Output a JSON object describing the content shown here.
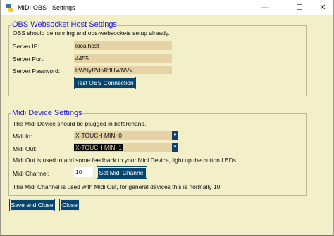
{
  "window": {
    "title": "MIDI-OBS - Settings",
    "controls": {
      "minimize": "—",
      "maximize": "☐",
      "close": "✕"
    }
  },
  "obs": {
    "heading": "OBS Websocket Host Settings",
    "note": "OBS should be running and obs-websockets setup already.",
    "ip_label": "Server IP:",
    "ip_value": "localhost",
    "port_label": "Server Port:",
    "port_value": "4455",
    "password_label": "Server Password:",
    "password_value": "hWNyfZdhRflUWNVk",
    "test_button": "Test OBS Connection"
  },
  "midi": {
    "heading": "Midi Device Settings",
    "note": "The Midi Device should be plugged in beforehand.",
    "in_label": "Midi In:",
    "in_value": "X-TOUCH MINI 0",
    "out_label": "Midi Out:",
    "out_value": "X-TOUCH MINI 1",
    "out_note": "Midi Out is used to add some feedback to your Midi Device, light up the button LEDs",
    "channel_label": "Midi Channel:",
    "channel_value": "10",
    "channel_button": "Set Midi Channel",
    "channel_note": "The Midi Channel is used with Midi Out, for general devices this is normally 10"
  },
  "footer": {
    "save_close": "Save and Close",
    "close": "Close"
  },
  "colors": {
    "background": "#f3efc8",
    "heading": "#1a1ae0",
    "field": "#e5d3a6",
    "button": "#06466e"
  }
}
